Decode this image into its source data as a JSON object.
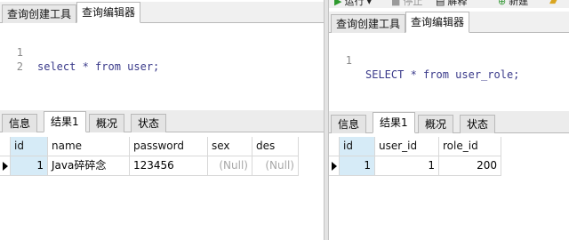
{
  "left": {
    "tabs": [
      "查询创建工具",
      "查询编辑器"
    ],
    "editor_lines": [
      {
        "num": "1",
        "code": "select * from user;"
      },
      {
        "num": "2",
        "code": ""
      }
    ],
    "result_tabs": [
      "信息",
      "结果1",
      "概况",
      "状态"
    ],
    "grid": {
      "columns": [
        "id",
        "name",
        "password",
        "sex",
        "des"
      ],
      "rows": [
        [
          "1",
          "Java碎碎念",
          "123456",
          "(Null)",
          "(Null)"
        ]
      ]
    }
  },
  "right": {
    "toolbar": {
      "run_label": "运行",
      "stop_label": "停止",
      "explain_label": "解释",
      "new_label": "新建"
    },
    "tabs": [
      "查询创建工具",
      "查询编辑器"
    ],
    "editor_lines": [
      {
        "num": "1",
        "code": "SELECT * from user_role;"
      }
    ],
    "result_tabs": [
      "信息",
      "结果1",
      "概况",
      "状态"
    ],
    "grid": {
      "columns": [
        "id",
        "user_id",
        "role_id"
      ],
      "rows": [
        [
          "1",
          "1",
          "200"
        ]
      ]
    }
  },
  "colors": {
    "selected_column": "#d6ebf7",
    "null_text": "#a8a8a8",
    "keyword_text": "#3a3a8a"
  }
}
